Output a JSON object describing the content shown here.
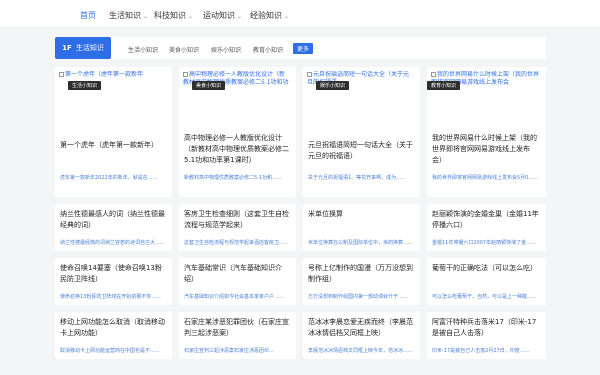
{
  "nav": {
    "items": [
      {
        "label": "首页",
        "active": true,
        "chevron": false
      },
      {
        "label": "生活知识",
        "active": false,
        "chevron": true
      },
      {
        "label": "科技知识",
        "active": false,
        "chevron": true
      },
      {
        "label": "运动知识",
        "active": false,
        "chevron": true
      },
      {
        "label": "经验知识",
        "active": false,
        "chevron": true
      }
    ],
    "chevron_glyph": "⌄"
  },
  "category": {
    "active_icon": "1F",
    "active_label": "生活知识",
    "links": [
      "生活小知识",
      "美食小知识",
      "娱乐小知识",
      "教育小知识"
    ],
    "more_label": "更多"
  },
  "cards": [
    {
      "alt": "第一个虎年（虎年第一款新年",
      "badge": "生活小知识",
      "title": "第一个虎年（虎年第一款新年）",
      "desc": "虎年第一款新年2022年的新年，就是在......"
    },
    {
      "alt": "高中物理必修一人教版优化设计（新教材高中物理优质教案必修二5.1功和功率第1课时）",
      "badge": "美食小知识",
      "title": "高中物理必修一人教版优化设计（新教材高中物理优质教案必修二5.1功和功率第1课时）",
      "desc": "新教材高中物理优质教案必修二5.1功和......"
    },
    {
      "alt": "元旦祝福语简短一句话大全（关于元旦的祝福语",
      "badge": "娱乐小知识",
      "title": "元旦祝福语简短一句话大全（关于元旦的祝福语）",
      "desc": "关于元旦的祝福语1、等花开来啊，成为......"
    },
    {
      "alt": "我的世界网易什么时候上架（我的世界即将官网网易游戏线上发布会",
      "badge": "教育小知识",
      "title": "我的世界网易什么时候上架（我的世界即将官网网易游戏线上发布会）",
      "desc": "我的世界即将官网网易游戏线上发布会5月0......"
    },
    {
      "title": "纳兰性德最感人的词（纳兰性德最经典的词）",
      "desc": "纳兰性德最经典的词纳兰容若的诗词自古大......"
    },
    {
      "title": "客房卫生检查细则（这套卫生自检流程与规范学起来）",
      "desc": "这套卫生自检流程与规范学起来酒店客房卫......"
    },
    {
      "title": "米单位换算",
      "desc": "米单位换算在公制及国际单位中，米的换算......"
    },
    {
      "title": "赵丽颖饰演的金婚金巢（金婚11年停播六口）",
      "desc": "金婚11年停播六口2007年赵丽颖饰演了金......"
    },
    {
      "title": "使命召唤14要塞（使命召唤13粉民防卫阵线）",
      "desc": "使命召唤13粉民防卫阵线在开始前那不你......"
    },
    {
      "title": "汽车基础常识（汽车基础知识介绍）",
      "desc": "汽车基础知识介绍如今社会基本家家户户......"
    },
    {
      "title": "号称上亿制作的国漫（万万没想到制作组）",
      "desc": "万万没想到制作组国内第一部动漫就什干......"
    },
    {
      "title": "葡萄干的正确吃法（可以怎么吃）",
      "desc": "可以怎么吃葡萄干，当然，可以是上一种酸......"
    },
    {
      "title": "移动上网功能怎么取消（取消移动卡上网功能）",
      "desc": "取消移动卡上网功能运营商在中国也是不......"
    },
    {
      "title": "石家庄某涉恶犯罪团伙（石家庄宣判三起涉恶案）",
      "desc": "石家庄宣判三起涉恶案石家庄涉恶团伙..."
    },
    {
      "title": "范冰冰李晨恋爱无疾而终（李晨范冰冰情侣档又同框上映）",
      "desc": "李晨范冰冰情侣档又同框上映今年，范冰冰......"
    },
    {
      "title": "阿富汗特种兵击落米17（印米-17是被自己人击落）",
      "desc": "印米-17是被自己人击落2月27日，印度......"
    }
  ]
}
